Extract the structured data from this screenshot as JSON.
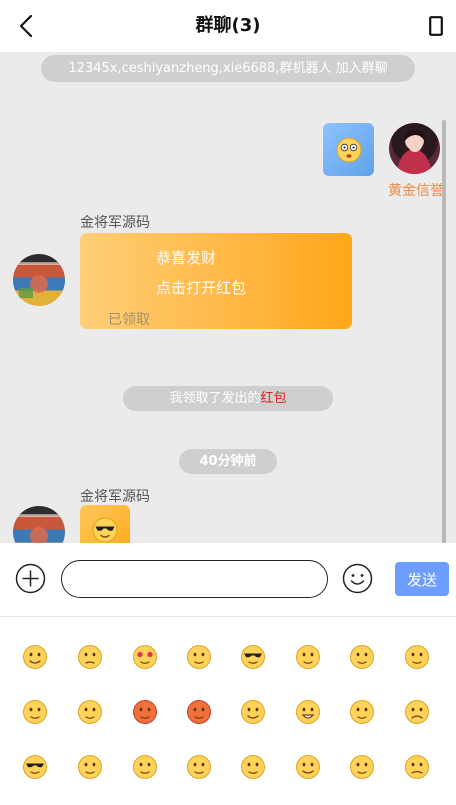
{
  "header": {
    "title": "群聊(3)",
    "back_icon": "chevron-left-icon",
    "menu_icon": "phone-icon"
  },
  "chat": {
    "join_notice": "12345x,ceshiyanzheng,xie6688,群机器人 加入群聊",
    "messages": [
      {
        "side": "right",
        "sender": "黄金信誉",
        "type": "emoji",
        "emoji": "dizzy-face"
      },
      {
        "side": "left",
        "sender": "金将军源码",
        "type": "red_packet",
        "greeting": "恭喜发财",
        "action": "点击打开红包",
        "status": "已领取"
      },
      {
        "side": "left",
        "sender": "金将军源码",
        "type": "emoji",
        "emoji": "cool-face"
      }
    ],
    "receipt_notice": {
      "prefix": "我领取了发出的",
      "highlight": "红包"
    },
    "time_stamp": "40分钟前"
  },
  "input_bar": {
    "message_value": "",
    "send_label": "发送",
    "plus_icon": "plus-circle-icon",
    "emoji_icon": "smile-icon"
  },
  "colors": {
    "chat_bg": "#ebebeb",
    "send_button": "#6d9eff",
    "red_packet": "#ffb640",
    "sender_gold": "#ee8844",
    "notice_red": "#e02020"
  },
  "emoji_panel": {
    "rows": [
      [
        "smile",
        "disappointed",
        "heart-eyes",
        "kissing",
        "cool",
        "scream",
        "blush",
        "zipper-mouth"
      ],
      [
        "sleepy",
        "cry",
        "angry",
        "rage",
        "smile",
        "grin",
        "smirk",
        "sad"
      ],
      [
        "cool",
        "flushed",
        "tears-of-joy",
        "vomit",
        "thinking",
        "smile",
        "shush",
        "worried"
      ]
    ]
  }
}
